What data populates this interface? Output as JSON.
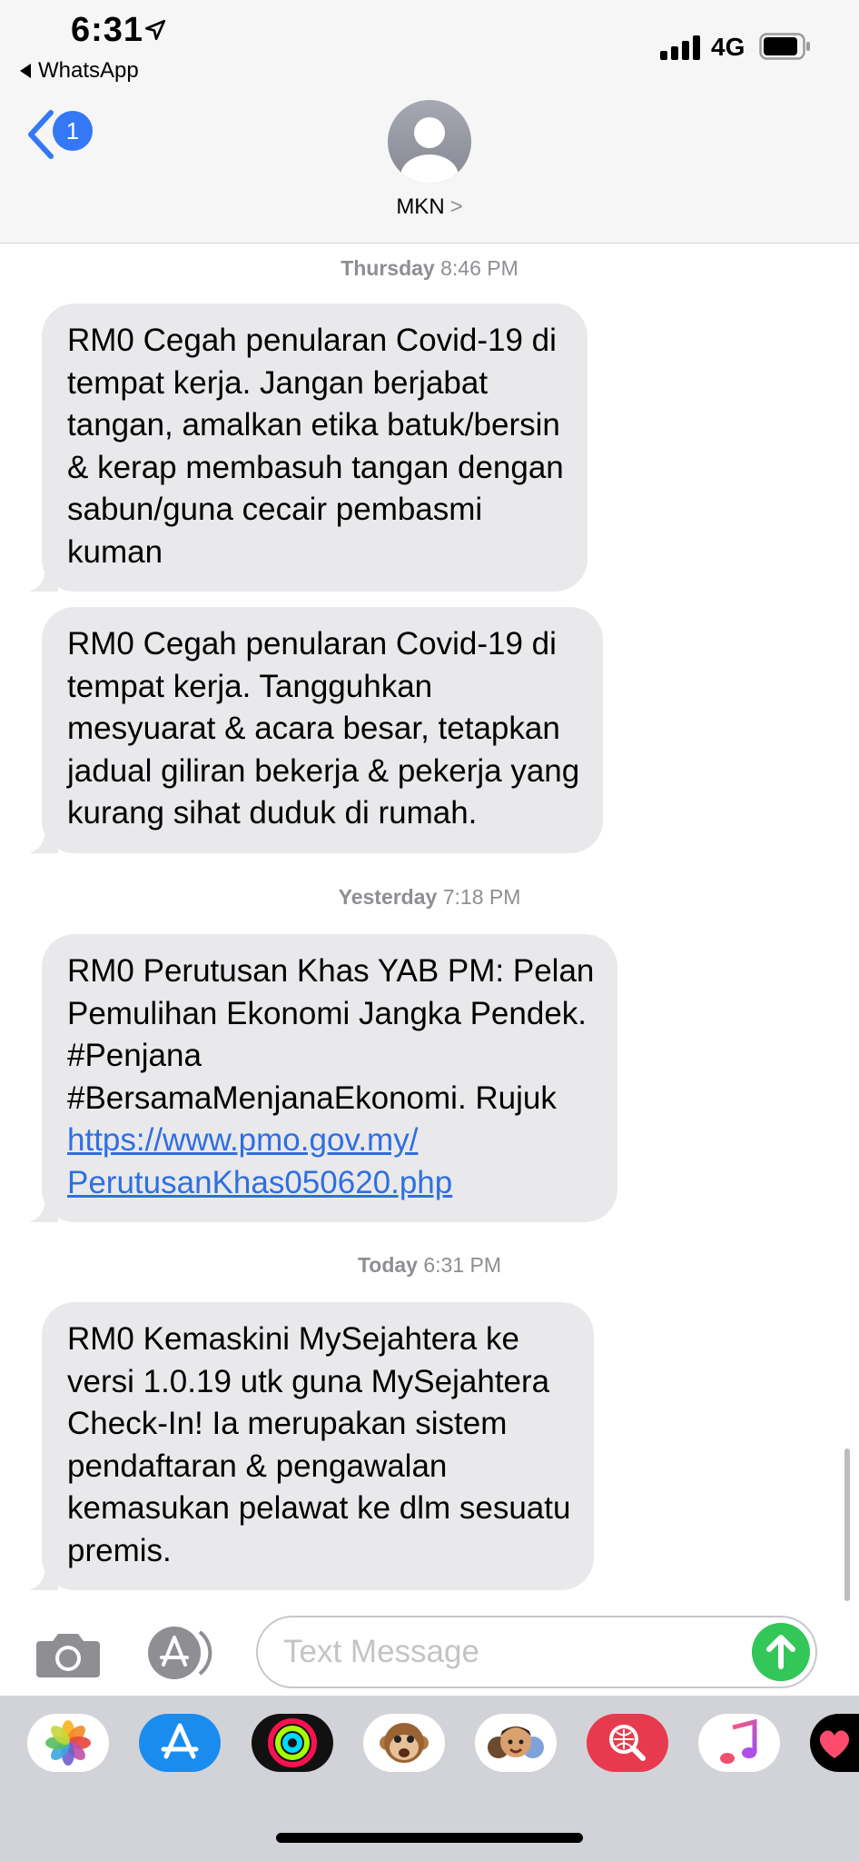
{
  "status_bar": {
    "time": "6:31",
    "back_app": "WhatsApp",
    "network": "4G",
    "icons": [
      "location-arrow-icon",
      "signal-bars-icon",
      "battery-icon"
    ]
  },
  "nav": {
    "back_badge": "1",
    "contact_name": "MKN",
    "contact_chevron": ">",
    "avatar_icon": "person-avatar-icon"
  },
  "thread": {
    "groups": [
      {
        "day": "Thursday",
        "time": "8:46 PM",
        "messages": [
          {
            "lines": [
              "RM0 Cegah penularan Covid-19 di",
              "tempat kerja. Jangan berjabat",
              "tangan, amalkan etika batuk/bersin",
              "& kerap membasuh tangan dengan",
              "sabun/guna cecair pembasmi",
              "kuman"
            ]
          },
          {
            "lines": [
              "RM0 Cegah penularan Covid-19 di",
              "tempat kerja. Tangguhkan",
              "mesyuarat & acara besar, tetapkan",
              "jadual giliran bekerja & pekerja yang",
              "kurang sihat duduk di rumah."
            ]
          }
        ]
      },
      {
        "day": "Yesterday",
        "time": "7:18 PM",
        "messages": [
          {
            "lines": [
              "RM0 Perutusan Khas YAB PM: Pelan",
              "Pemulihan Ekonomi Jangka Pendek.",
              "#Penjana",
              "#BersamaMenjanaEkonomi. Rujuk"
            ],
            "link_lines": [
              "https://www.pmo.gov.my/",
              "PerutusanKhas050620.php"
            ]
          }
        ]
      },
      {
        "day": "Today",
        "time": "6:31 PM",
        "messages": [
          {
            "lines": [
              "RM0 Kemaskini MySejahtera ke",
              "versi 1.0.19 utk guna MySejahtera",
              "Check-In! Ia merupakan sistem",
              "pendaftaran & pengawalan",
              "kemasukan pelawat ke dlm sesuatu",
              "premis."
            ]
          }
        ]
      }
    ]
  },
  "composer": {
    "placeholder": "Text Message",
    "icons": [
      "camera-icon",
      "app-store-icon",
      "send-arrow-icon"
    ]
  },
  "app_drawer": {
    "apps": [
      "photos-icon",
      "app-store-icon",
      "activity-rings-icon",
      "monkey-animoji-icon",
      "memoji-icon",
      "image-search-icon",
      "music-icon",
      "heart-sticker-icon"
    ]
  },
  "colors": {
    "bubble": "#e9e9eb",
    "link": "#2f6fe0",
    "accent_blue": "#3478f6",
    "send_green": "#33c759",
    "timestamp": "#8e8e93"
  }
}
